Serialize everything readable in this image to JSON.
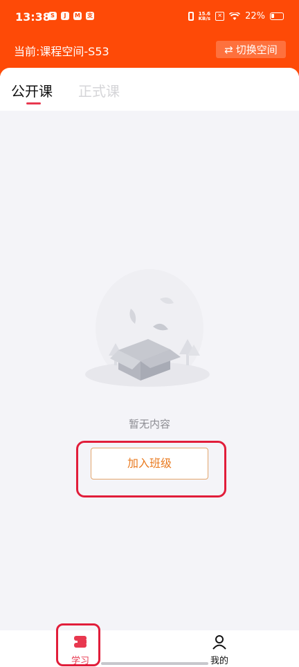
{
  "status_bar": {
    "time": "13:38",
    "notification_icons": [
      "app-notification-icon",
      "app-notification-icon",
      "app-notification-icon",
      "alipay-icon"
    ],
    "notification_glyphs": [
      "S",
      "J",
      "M",
      "支"
    ],
    "net_speed_top": "15.6",
    "net_speed_bottom": "KB/s",
    "battery": "22%"
  },
  "header": {
    "space_label": "当前:课程空间-S53",
    "switch_button": "切换空间",
    "switch_icon": "⇄"
  },
  "tabs": [
    {
      "label": "公开课",
      "active": true
    },
    {
      "label": "正式课",
      "active": false
    }
  ],
  "empty_state": {
    "text": "暂无内容",
    "join_button": "加入班级"
  },
  "bottom_nav": {
    "items": [
      {
        "label": "学习",
        "icon": "book-stack-icon",
        "active": true
      },
      {
        "label": "我的",
        "icon": "user-icon",
        "active": false
      }
    ]
  },
  "colors": {
    "brand": "#fe4a07",
    "accent": "#e8384f",
    "join_text": "#e97a1f",
    "background": "#f4f4f8"
  }
}
